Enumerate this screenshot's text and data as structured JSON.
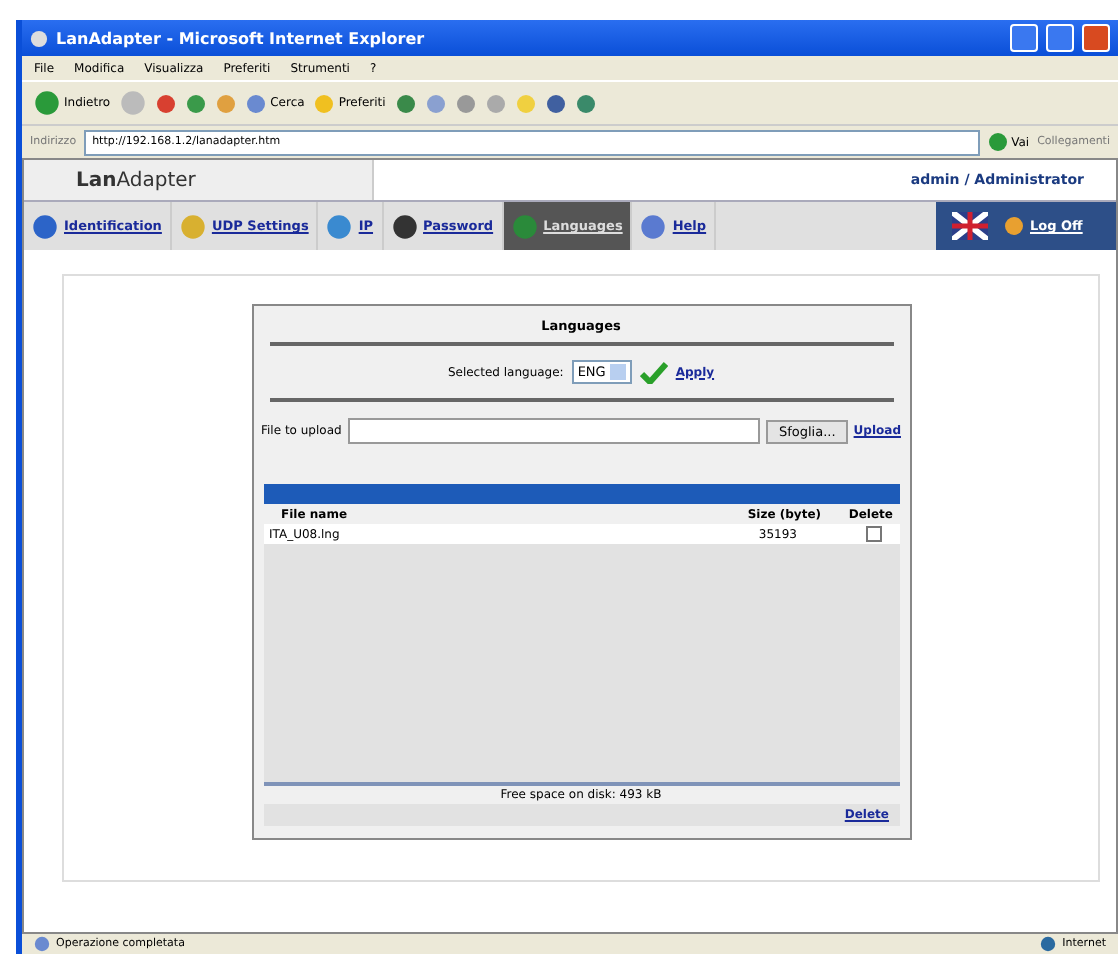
{
  "window": {
    "title": "LanAdapter - Microsoft Internet Explorer"
  },
  "menu": [
    "File",
    "Modifica",
    "Visualizza",
    "Preferiti",
    "Strumenti",
    "?"
  ],
  "toolbar": {
    "back": "Indietro",
    "search": "Cerca",
    "favorites": "Preferiti"
  },
  "address_bar": {
    "label": "Indirizzo",
    "url": "http://192.168.1.2/lanadapter.htm",
    "go": "Vai",
    "links": "Collegamenti"
  },
  "app": {
    "brand": "**Lan**Adapter",
    "user": "admin / Administrator"
  },
  "nav": [
    {
      "label": "Identification",
      "selected": false
    },
    {
      "label": "UDP Settings",
      "selected": false
    },
    {
      "label": "IP",
      "selected": false
    },
    {
      "label": "Password",
      "selected": false
    },
    {
      "label": "Languages",
      "selected": true
    },
    {
      "label": "Help",
      "selected": false
    }
  ],
  "logoff": "Log Off",
  "panel": {
    "title": "Languages",
    "language_label": "Selected language:",
    "language": "ENG",
    "apply": "Apply",
    "file_label": "File to upload",
    "browse": "Sfoglia...",
    "upload": "Upload",
    "columns": [
      "File name",
      "Size (byte)",
      "Delete"
    ],
    "rows": [
      {
        "file": "ITA_U08.lng",
        "size": "35193",
        "checked": false
      }
    ],
    "free_space": "Free space on disk: 493 kB",
    "delete": "Delete"
  },
  "status_bar": {
    "text": "Operazione completata",
    "zone": "Internet"
  }
}
